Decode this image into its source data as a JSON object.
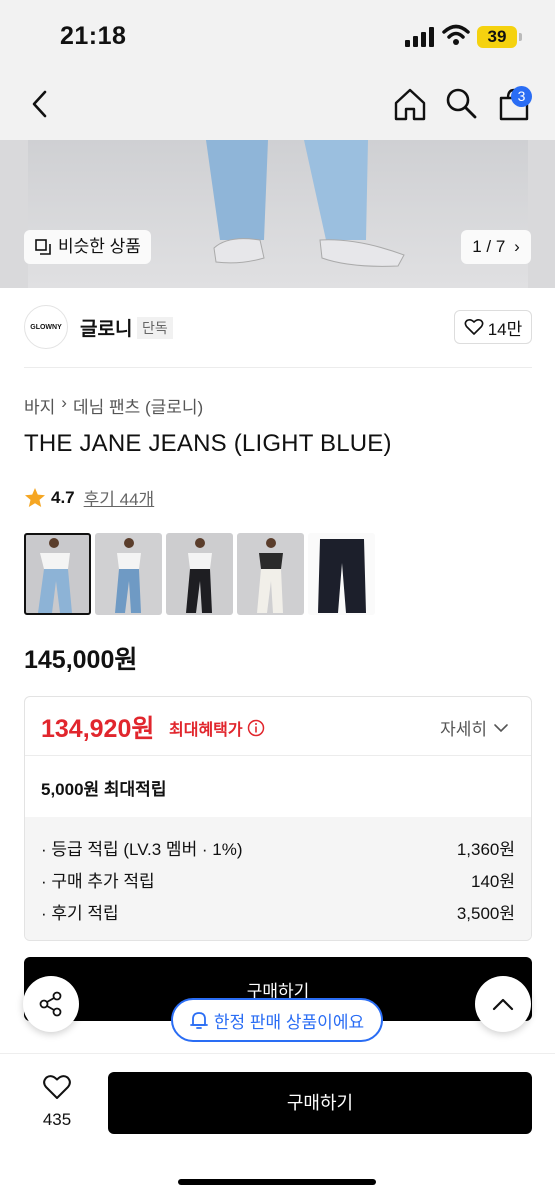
{
  "status_bar": {
    "time": "21:18",
    "battery": "39"
  },
  "nav": {
    "cart_count": "3"
  },
  "hero": {
    "similar_label": "비슷한 상품",
    "pager": "1 / 7"
  },
  "brand": {
    "logo_text": "GLOWNY",
    "name": "글로니",
    "tag": "단독",
    "likes": "14만"
  },
  "product": {
    "breadcrumb": [
      "바지",
      "데님 팬츠 (글로니)"
    ],
    "title": "THE JANE JEANS (LIGHT BLUE)",
    "rating": "4.7",
    "reviews": "후기 44개",
    "price": "145,000원"
  },
  "benefit": {
    "price": "134,920원",
    "max_label": "최대혜택가",
    "detail_label": "자세히",
    "points": "5,000원 최대적립",
    "rows": [
      {
        "label": "· 등급 적립 (LV.3 멤버 · 1%)",
        "value": "1,360원"
      },
      {
        "label": "· 구매 추가 적립",
        "value": "140원"
      },
      {
        "label": "· 후기 적립",
        "value": "3,500원"
      }
    ]
  },
  "actions": {
    "buy_inline": "구매하기",
    "limited": "한정 판매 상품이에요",
    "wish_count": "435",
    "buy_bottom": "구매하기"
  },
  "colors": {
    "accent_red": "#e1262d",
    "accent_blue": "#2a6df4",
    "star": "#f5a623"
  }
}
